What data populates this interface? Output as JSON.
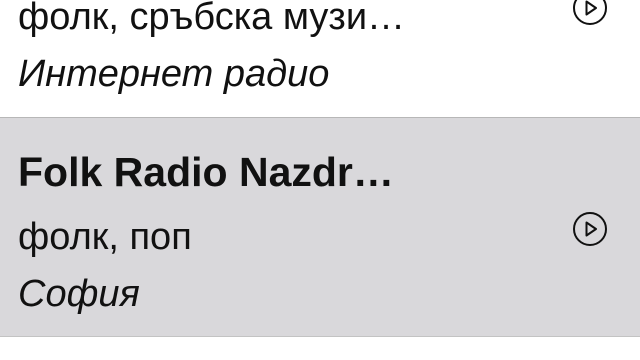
{
  "stations": [
    {
      "title": "",
      "genre": "фолк, сръбска музи…",
      "location": "Интернет радио",
      "play_icon": "play-circle-icon",
      "selected": false
    },
    {
      "title": "Folk Radio Nazdr…",
      "genre": "фолк, поп",
      "location": "София",
      "play_icon": "play-circle-icon",
      "selected": true
    }
  ],
  "colors": {
    "selected_row_background": "#d9d8db",
    "row_background": "#ffffff",
    "text": "#111111",
    "divider": "#b7b7b7"
  }
}
